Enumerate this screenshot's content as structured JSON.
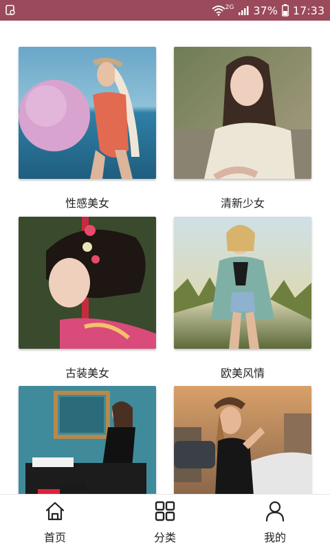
{
  "status_bar": {
    "network": "2G",
    "battery": "37%",
    "time": "17:33"
  },
  "categories": [
    {
      "label": "性感美女",
      "icon": "photo-beach-woman"
    },
    {
      "label": "清新少女",
      "icon": "photo-young-woman"
    },
    {
      "label": "古装美女",
      "icon": "photo-kimono-woman"
    },
    {
      "label": "欧美风情",
      "icon": "photo-western-woman"
    },
    {
      "label": "",
      "icon": "photo-piano-woman"
    },
    {
      "label": "",
      "icon": "photo-street-woman"
    }
  ],
  "tabbar": {
    "home": "首页",
    "category": "分类",
    "mine": "我的"
  },
  "colors": {
    "status_bar": "#9b4a5b",
    "text": "#222222"
  }
}
